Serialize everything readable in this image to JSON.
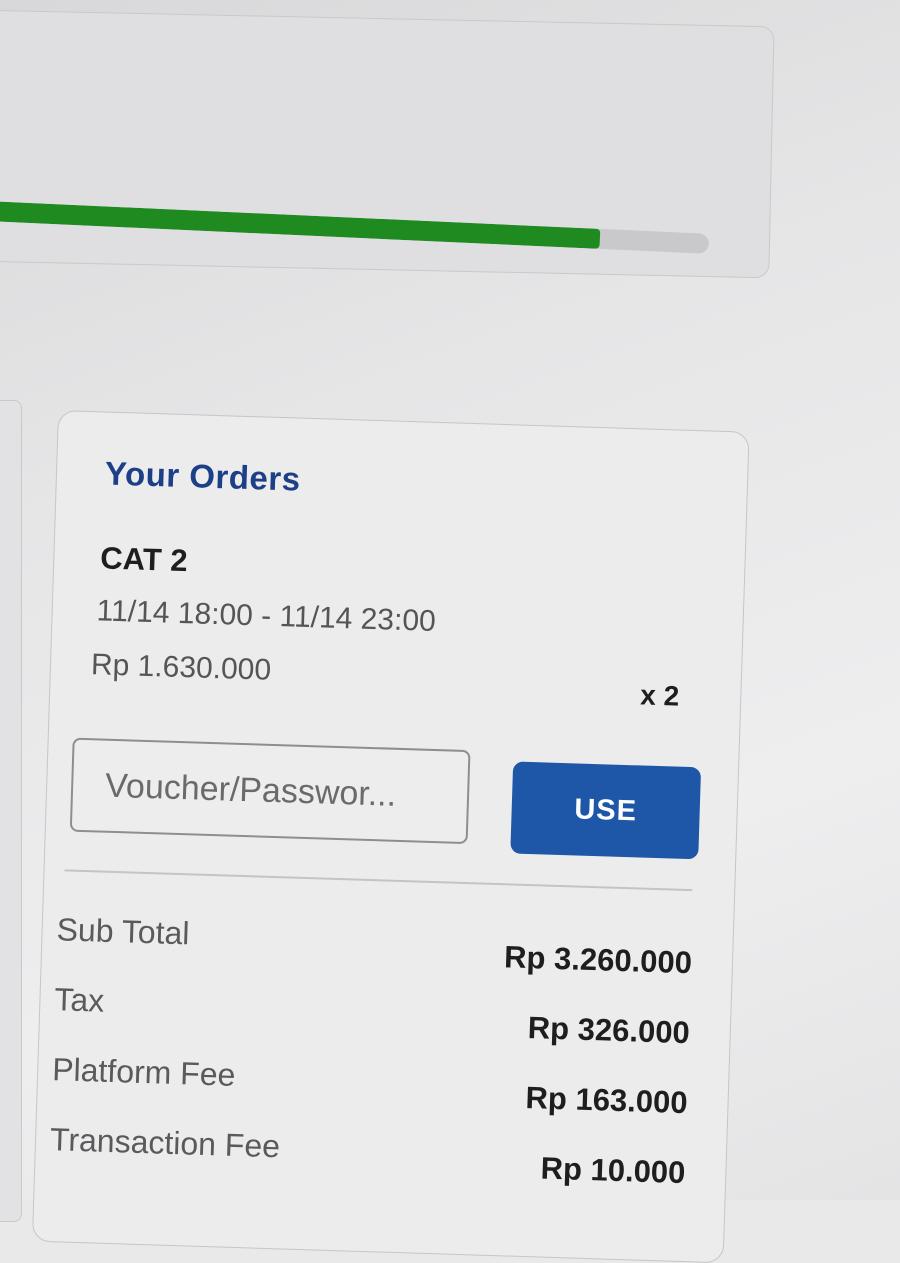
{
  "progress": {
    "fraction": 0.85,
    "fill_color": "#1f8a1f",
    "track_color": "#c9c9cc"
  },
  "orders": {
    "title": "Your Orders",
    "item": {
      "name": "CAT 2",
      "time_range": "11/14 18:00 - 11/14 23:00",
      "price": "Rp 1.630.000",
      "quantity": "x 2"
    },
    "voucher": {
      "placeholder": "Voucher/Passwor...",
      "value": "",
      "button_label": "USE"
    },
    "summary": [
      {
        "label": "Sub Total",
        "value": "Rp 3.260.000"
      },
      {
        "label": "Tax",
        "value": "Rp 326.000"
      },
      {
        "label": "Platform Fee",
        "value": "Rp 163.000"
      },
      {
        "label": "Transaction Fee",
        "value": "Rp 10.000"
      }
    ]
  },
  "colors": {
    "title_blue": "#1c3f87",
    "button_blue": "#1f57a8"
  }
}
